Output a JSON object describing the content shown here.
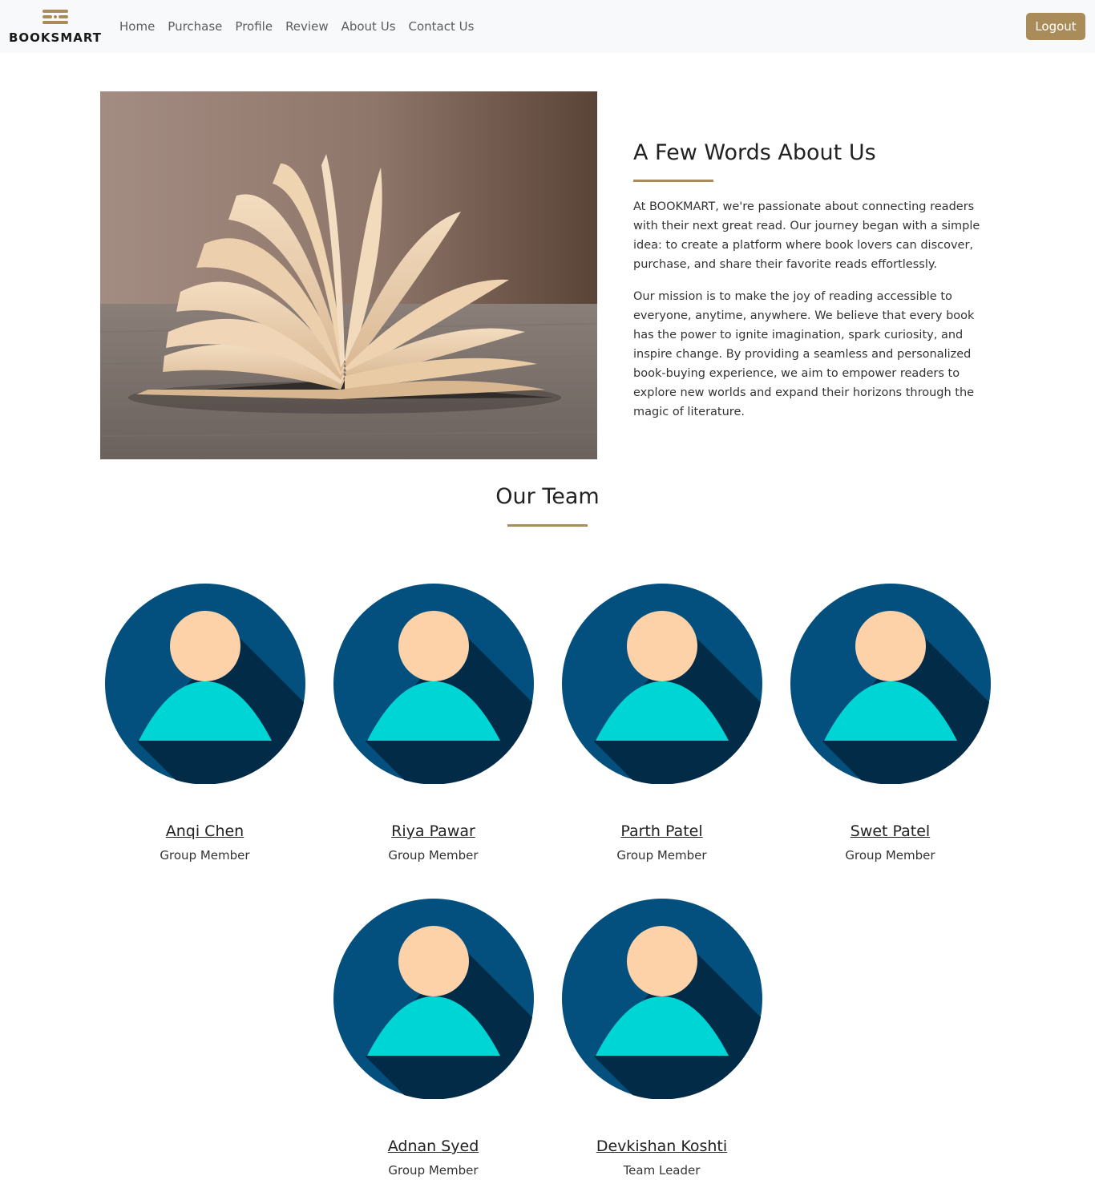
{
  "navbar": {
    "brand": "BOOKSMART",
    "links": [
      "Home",
      "Purchase",
      "Profile",
      "Review",
      "About Us",
      "Contact Us"
    ],
    "logout_label": "Logout"
  },
  "about": {
    "title": "A Few Words About Us",
    "paragraph_1": "At BOOKMART, we're passionate about connecting readers with their next great read. Our journey began with a simple idea: to create a platform where book lovers can discover, purchase, and share their favorite reads effortlessly.",
    "paragraph_2": "Our mission is to make the joy of reading accessible to everyone, anytime, anywhere. We believe that every book has the power to ignite imagination, spark curiosity, and inspire change. By providing a seamless and personalized book-buying experience, we aim to empower readers to explore new worlds and expand their horizons through the magic of literature."
  },
  "team": {
    "title": "Our Team",
    "members": [
      {
        "name": "Anqi Chen",
        "role": "Group Member"
      },
      {
        "name": "Riya Pawar",
        "role": "Group Member"
      },
      {
        "name": "Parth Patel",
        "role": "Group Member"
      },
      {
        "name": "Swet Patel",
        "role": "Group Member"
      },
      {
        "name": "Adnan Syed",
        "role": "Group Member"
      },
      {
        "name": "Devkishan Koshti",
        "role": "Team Leader"
      }
    ]
  },
  "colors": {
    "accent": "#a98c59",
    "avatar_bg": "#03507f",
    "avatar_shadow": "#022b48",
    "avatar_head": "#fdd2a8",
    "avatar_body": "#00d5d5"
  },
  "icons": {
    "brand_logo": "books-logo-icon",
    "hero": "open-book-image",
    "avatar": "user-avatar-icon"
  }
}
